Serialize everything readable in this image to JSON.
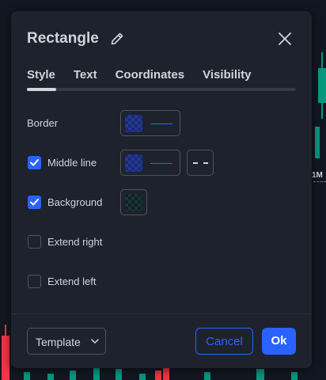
{
  "chart_background": {
    "price_label": "1M",
    "colors": {
      "up": "#089981",
      "down": "#f23645"
    }
  },
  "dialog": {
    "title": "Rectangle",
    "tabs": [
      {
        "label": "Style",
        "active": true
      },
      {
        "label": "Text",
        "active": false
      },
      {
        "label": "Coordinates",
        "active": false
      },
      {
        "label": "Visibility",
        "active": false
      }
    ],
    "rows": {
      "border": {
        "label": "Border"
      },
      "middle_line": {
        "label": "Middle line",
        "checked": true
      },
      "background": {
        "label": "Background",
        "checked": true
      },
      "extend_right": {
        "label": "Extend right",
        "checked": false
      },
      "extend_left": {
        "label": "Extend left",
        "checked": false
      }
    },
    "footer": {
      "template_label": "Template",
      "cancel_label": "Cancel",
      "ok_label": "Ok"
    },
    "colors": {
      "accent": "#2962ff",
      "panel": "#1e222d",
      "text": "#d1d4dc",
      "border_swatch": "#1a2a6e",
      "background_swatch": "#0f2222"
    },
    "icons": {
      "edit": "pencil-icon",
      "close": "close-icon",
      "check": "check-icon",
      "dropdown": "chevron-down-icon"
    }
  }
}
